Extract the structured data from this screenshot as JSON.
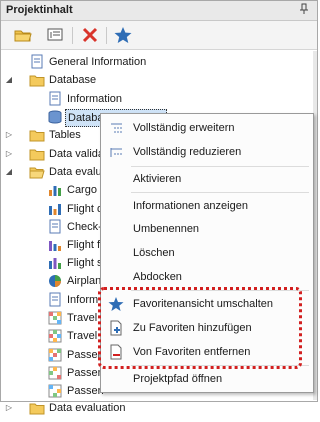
{
  "panel": {
    "title": "Projektinhalt",
    "pin_glyph": "ᵖ"
  },
  "toolbar": {
    "icons": [
      "open-folder-icon",
      "properties-icon",
      "delete-icon",
      "favorite-star-icon"
    ]
  },
  "tree": {
    "items": [
      {
        "label": "General Information"
      },
      {
        "label": "Database"
      },
      {
        "label": "Information"
      },
      {
        "label": "Database Definition"
      },
      {
        "label": "Tables"
      },
      {
        "label": "Data validation"
      },
      {
        "label": "Data evaluation"
      },
      {
        "label": "Cargo"
      },
      {
        "label": "Flight d"
      },
      {
        "label": "Check-"
      },
      {
        "label": "Flight f"
      },
      {
        "label": "Flight s"
      },
      {
        "label": "Airplan"
      },
      {
        "label": "Inform"
      },
      {
        "label": "Travel"
      },
      {
        "label": "Travel"
      },
      {
        "label": "Passen"
      },
      {
        "label": "Passen"
      },
      {
        "label": "Passen"
      },
      {
        "label": "Data evaluation"
      }
    ]
  },
  "menu": {
    "items": [
      {
        "label": "Vollständig erweitern"
      },
      {
        "label": "Vollständig reduzieren"
      },
      {
        "label": "Aktivieren"
      },
      {
        "label": "Informationen anzeigen"
      },
      {
        "label": "Umbenennen"
      },
      {
        "label": "Löschen"
      },
      {
        "label": "Abdocken"
      },
      {
        "label": "Favoritenansicht umschalten"
      },
      {
        "label": "Zu Favoriten hinzufügen"
      },
      {
        "label": "Von Favoriten entfernen"
      },
      {
        "label": "Projektpfad öffnen"
      }
    ],
    "highlight_color": "#d21f1f"
  }
}
